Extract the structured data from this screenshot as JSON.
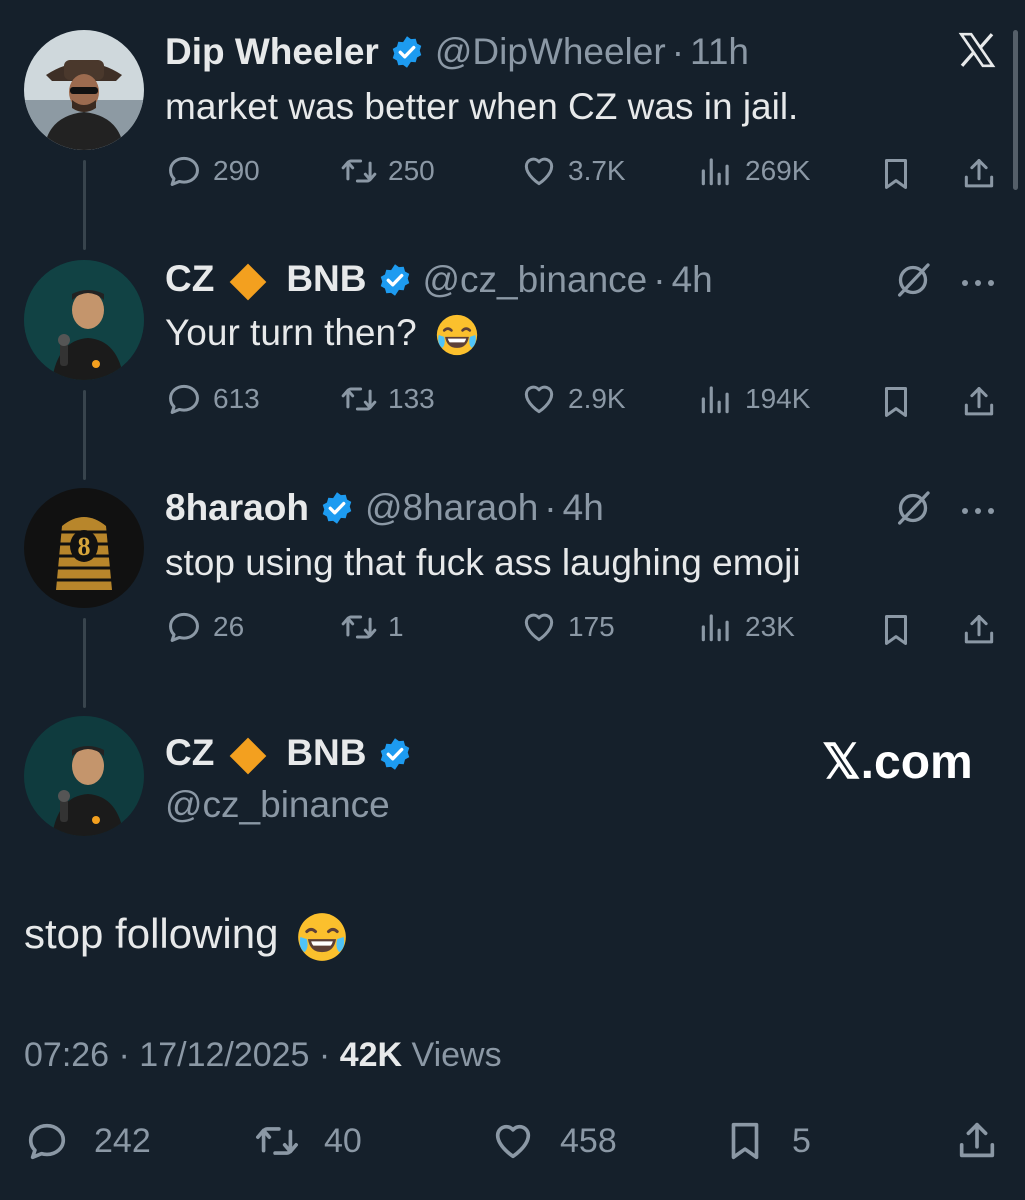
{
  "tweets": [
    {
      "name": "Dip Wheeler",
      "handle": "@DipWheeler",
      "time": "11h",
      "text": "market was better when CZ was in jail.",
      "replies": "290",
      "retweets": "250",
      "likes": "3.7K",
      "views": "269K"
    },
    {
      "name_prefix": "CZ",
      "name_suffix": "BNB",
      "handle": "@cz_binance",
      "time": "4h",
      "text": "Your turn then?",
      "replies": "613",
      "retweets": "133",
      "likes": "2.9K",
      "views": "194K"
    },
    {
      "name": "8haraoh",
      "handle": "@8haraoh",
      "time": "4h",
      "text": "stop using that fuck ass laughing emoji",
      "replies": "26",
      "retweets": "1",
      "likes": "175",
      "views": "23K"
    }
  ],
  "main_tweet": {
    "name_prefix": "CZ",
    "name_suffix": "BNB",
    "handle": "@cz_binance",
    "text": "stop following",
    "timestamp": "07:26 · 17/12/2025 ·",
    "views_count": "42K",
    "views_label": "Views",
    "replies": "242",
    "retweets": "40",
    "likes": "458",
    "bookmarks": "5"
  },
  "watermark": "𝕏.com",
  "dot": "·",
  "icons": {
    "x_logo": "x-logo-icon",
    "grok": "grok-icon",
    "more": "more-icon",
    "reply": "reply-icon",
    "retweet": "retweet-icon",
    "like": "heart-icon",
    "views": "views-icon",
    "bookmark": "bookmark-icon",
    "share": "share-icon"
  },
  "colors": {
    "background": "#15202b",
    "secondary": "#8b98a5",
    "verified": "#1d9bf0",
    "bnb": "#f3a01f"
  }
}
